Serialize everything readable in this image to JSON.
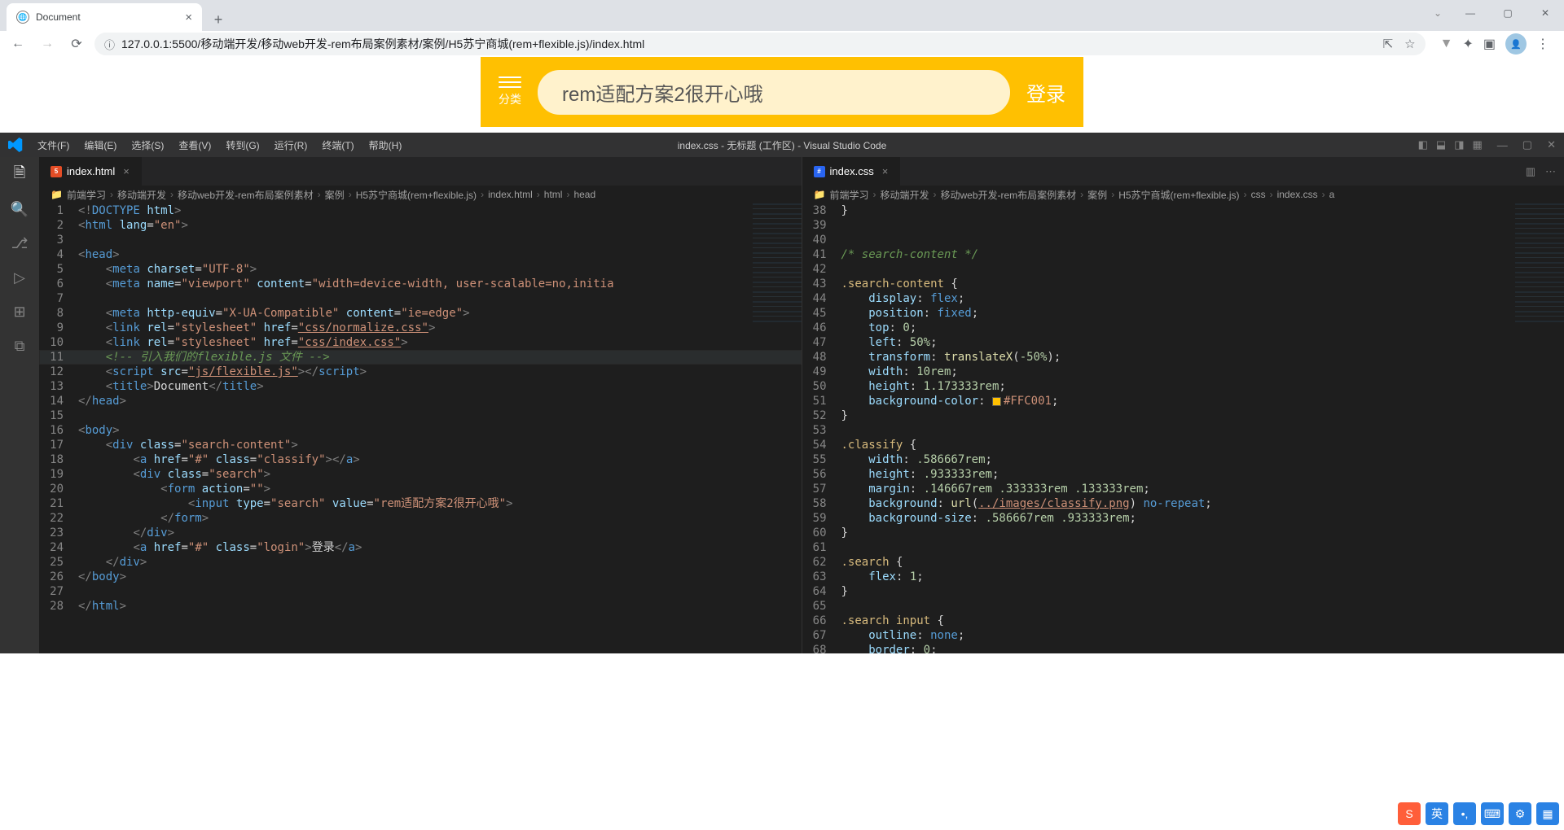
{
  "chrome": {
    "tabTitle": "Document",
    "url": "127.0.0.1:5500/移动端开发/移动web开发-rem布局案例素材/案例/H5苏宁商城(rem+flexible.js)/index.html"
  },
  "webpage": {
    "classify": "分类",
    "searchValue": "rem适配方案2很开心哦",
    "login": "登录"
  },
  "vscode": {
    "title": "index.css - 无标题 (工作区) - Visual Studio Code",
    "menus": [
      "文件(F)",
      "编辑(E)",
      "选择(S)",
      "查看(V)",
      "转到(G)",
      "运行(R)",
      "终端(T)",
      "帮助(H)"
    ],
    "leftTab": "index.html",
    "rightTab": "index.css",
    "leftBreadcrumbs": [
      "前端学习",
      "移动端开发",
      "移动web开发-rem布局案例素材",
      "案例",
      "H5苏宁商城(rem+flexible.js)",
      "index.html",
      "html",
      "head"
    ],
    "rightBreadcrumbs": [
      "前端学习",
      "移动端开发",
      "移动web开发-rem布局案例素材",
      "案例",
      "H5苏宁商城(rem+flexible.js)",
      "css",
      "index.css",
      "a"
    ],
    "leftLines": [
      {
        "n": 1,
        "h": "<span class='brk'>&lt;!</span><span class='tag'>DOCTYPE</span> <span class='attr'>html</span><span class='brk'>&gt;</span>"
      },
      {
        "n": 2,
        "h": "<span class='brk'>&lt;</span><span class='tag'>html</span> <span class='attr'>lang</span>=<span class='str'>\"en\"</span><span class='brk'>&gt;</span>"
      },
      {
        "n": 3,
        "h": ""
      },
      {
        "n": 4,
        "h": "<span class='brk'>&lt;</span><span class='tag'>head</span><span class='brk'>&gt;</span>"
      },
      {
        "n": 5,
        "h": "    <span class='brk'>&lt;</span><span class='tag'>meta</span> <span class='attr'>charset</span>=<span class='str'>\"UTF-8\"</span><span class='brk'>&gt;</span>"
      },
      {
        "n": 6,
        "h": "    <span class='brk'>&lt;</span><span class='tag'>meta</span> <span class='attr'>name</span>=<span class='str'>\"viewport\"</span> <span class='attr'>content</span>=<span class='str'>\"width=device-width, user-scalable=no,initia</span>"
      },
      {
        "n": 7,
        "h": ""
      },
      {
        "n": 8,
        "h": "    <span class='brk'>&lt;</span><span class='tag'>meta</span> <span class='attr'>http-equiv</span>=<span class='str'>\"X-UA-Compatible\"</span> <span class='attr'>content</span>=<span class='str'>\"ie=edge\"</span><span class='brk'>&gt;</span>"
      },
      {
        "n": 9,
        "h": "    <span class='brk'>&lt;</span><span class='tag'>link</span> <span class='attr'>rel</span>=<span class='str'>\"stylesheet\"</span> <span class='attr'>href</span>=<span class='str link'>\"css/normalize.css\"</span><span class='brk'>&gt;</span>"
      },
      {
        "n": 10,
        "h": "    <span class='brk'>&lt;</span><span class='tag'>link</span> <span class='attr'>rel</span>=<span class='str'>\"stylesheet\"</span> <span class='attr'>href</span>=<span class='str link'>\"css/index.css\"</span><span class='brk'>&gt;</span>"
      },
      {
        "n": 11,
        "h": "    <span class='cmt'>&lt;!-- 引入我们的flexible.js 文件 --&gt;</span>",
        "sel": true
      },
      {
        "n": 12,
        "h": "    <span class='brk'>&lt;</span><span class='tag'>script</span> <span class='attr'>src</span>=<span class='str link'>\"js/flexible.js\"</span><span class='brk'>&gt;&lt;/</span><span class='tag'>script</span><span class='brk'>&gt;</span>"
      },
      {
        "n": 13,
        "h": "    <span class='brk'>&lt;</span><span class='tag'>title</span><span class='brk'>&gt;</span>Document<span class='brk'>&lt;/</span><span class='tag'>title</span><span class='brk'>&gt;</span>"
      },
      {
        "n": 14,
        "h": "<span class='brk'>&lt;/</span><span class='tag'>head</span><span class='brk'>&gt;</span>"
      },
      {
        "n": 15,
        "h": ""
      },
      {
        "n": 16,
        "h": "<span class='brk'>&lt;</span><span class='tag'>body</span><span class='brk'>&gt;</span>"
      },
      {
        "n": 17,
        "h": "    <span class='brk'>&lt;</span><span class='tag'>div</span> <span class='attr'>class</span>=<span class='str'>\"search-content\"</span><span class='brk'>&gt;</span>"
      },
      {
        "n": 18,
        "h": "        <span class='brk'>&lt;</span><span class='tag'>a</span> <span class='attr'>href</span>=<span class='str'>\"#\"</span> <span class='attr'>class</span>=<span class='str'>\"classify\"</span><span class='brk'>&gt;&lt;/</span><span class='tag'>a</span><span class='brk'>&gt;</span>"
      },
      {
        "n": 19,
        "h": "        <span class='brk'>&lt;</span><span class='tag'>div</span> <span class='attr'>class</span>=<span class='str'>\"search\"</span><span class='brk'>&gt;</span>"
      },
      {
        "n": 20,
        "h": "            <span class='brk'>&lt;</span><span class='tag'>form</span> <span class='attr'>action</span>=<span class='str'>\"\"</span><span class='brk'>&gt;</span>"
      },
      {
        "n": 21,
        "h": "                <span class='brk'>&lt;</span><span class='tag'>input</span> <span class='attr'>type</span>=<span class='str'>\"search\"</span> <span class='attr'>value</span>=<span class='str'>\"rem适配方案2很开心哦\"</span><span class='brk'>&gt;</span>"
      },
      {
        "n": 22,
        "h": "            <span class='brk'>&lt;/</span><span class='tag'>form</span><span class='brk'>&gt;</span>"
      },
      {
        "n": 23,
        "h": "        <span class='brk'>&lt;/</span><span class='tag'>div</span><span class='brk'>&gt;</span>"
      },
      {
        "n": 24,
        "h": "        <span class='brk'>&lt;</span><span class='tag'>a</span> <span class='attr'>href</span>=<span class='str'>\"#\"</span> <span class='attr'>class</span>=<span class='str'>\"login\"</span><span class='brk'>&gt;</span>登录<span class='brk'>&lt;/</span><span class='tag'>a</span><span class='brk'>&gt;</span>"
      },
      {
        "n": 25,
        "h": "    <span class='brk'>&lt;/</span><span class='tag'>div</span><span class='brk'>&gt;</span>"
      },
      {
        "n": 26,
        "h": "<span class='brk'>&lt;/</span><span class='tag'>body</span><span class='brk'>&gt;</span>"
      },
      {
        "n": 27,
        "h": ""
      },
      {
        "n": 28,
        "h": "<span class='brk'>&lt;/</span><span class='tag'>html</span><span class='brk'>&gt;</span>"
      }
    ],
    "rightLines": [
      {
        "n": 38,
        "h": "<span class='pun'>}</span>"
      },
      {
        "n": 39,
        "h": ""
      },
      {
        "n": 40,
        "h": ""
      },
      {
        "n": 41,
        "h": "<span class='cmt'>/* search-content */</span>"
      },
      {
        "n": 42,
        "h": ""
      },
      {
        "n": 43,
        "h": "<span class='sel2'>.search-content</span> <span class='pun'>{</span>"
      },
      {
        "n": 44,
        "h": "    <span class='prop'>display</span><span class='pun'>:</span> <span class='kw'>flex</span><span class='pun'>;</span>"
      },
      {
        "n": 45,
        "h": "    <span class='prop'>position</span><span class='pun'>:</span> <span class='kw'>fixed</span><span class='pun'>;</span>"
      },
      {
        "n": 46,
        "h": "    <span class='prop'>top</span><span class='pun'>:</span> <span class='num'>0</span><span class='pun'>;</span>"
      },
      {
        "n": 47,
        "h": "    <span class='prop'>left</span><span class='pun'>:</span> <span class='num'>50%</span><span class='pun'>;</span>"
      },
      {
        "n": 48,
        "h": "    <span class='prop'>transform</span><span class='pun'>:</span> <span class='fn'>translateX</span><span class='pun'>(</span><span class='num'>-50%</span><span class='pun'>);</span>"
      },
      {
        "n": 49,
        "h": "    <span class='prop'>width</span><span class='pun'>:</span> <span class='num'>10rem</span><span class='pun'>;</span>"
      },
      {
        "n": 50,
        "h": "    <span class='prop'>height</span><span class='pun'>:</span> <span class='num'>1.173333rem</span><span class='pun'>;</span>"
      },
      {
        "n": 51,
        "h": "    <span class='prop'>background-color</span><span class='pun'>:</span> <span class='colorbox'></span><span class='str'>#FFC001</span><span class='pun'>;</span>"
      },
      {
        "n": 52,
        "h": "<span class='pun'>}</span>"
      },
      {
        "n": 53,
        "h": ""
      },
      {
        "n": 54,
        "h": "<span class='sel2'>.classify</span> <span class='pun'>{</span>"
      },
      {
        "n": 55,
        "h": "    <span class='prop'>width</span><span class='pun'>:</span> <span class='num'>.586667rem</span><span class='pun'>;</span>"
      },
      {
        "n": 56,
        "h": "    <span class='prop'>height</span><span class='pun'>:</span> <span class='num'>.933333rem</span><span class='pun'>;</span>"
      },
      {
        "n": 57,
        "h": "    <span class='prop'>margin</span><span class='pun'>:</span> <span class='num'>.146667rem .333333rem .133333rem</span><span class='pun'>;</span>"
      },
      {
        "n": 58,
        "h": "    <span class='prop'>background</span><span class='pun'>:</span> <span class='fn'>url</span><span class='pun'>(</span><span class='str link'>../images/classify.png</span><span class='pun'>)</span> <span class='kw'>no-repeat</span><span class='pun'>;</span>"
      },
      {
        "n": 59,
        "h": "    <span class='prop'>background-size</span><span class='pun'>:</span> <span class='num'>.586667rem .933333rem</span><span class='pun'>;</span>"
      },
      {
        "n": 60,
        "h": "<span class='pun'>}</span>"
      },
      {
        "n": 61,
        "h": ""
      },
      {
        "n": 62,
        "h": "<span class='sel2'>.search</span> <span class='pun'>{</span>"
      },
      {
        "n": 63,
        "h": "    <span class='prop'>flex</span><span class='pun'>:</span> <span class='num'>1</span><span class='pun'>;</span>"
      },
      {
        "n": 64,
        "h": "<span class='pun'>}</span>"
      },
      {
        "n": 65,
        "h": ""
      },
      {
        "n": 66,
        "h": "<span class='sel2'>.search input</span> <span class='pun'>{</span>"
      },
      {
        "n": 67,
        "h": "    <span class='prop'>outline</span><span class='pun'>:</span> <span class='kw'>none</span><span class='pun'>;</span>"
      },
      {
        "n": 68,
        "h": "    <span class='prop'>border</span><span class='pun'>:</span> <span class='num'>0</span><span class='pun'>;</span>"
      }
    ]
  }
}
